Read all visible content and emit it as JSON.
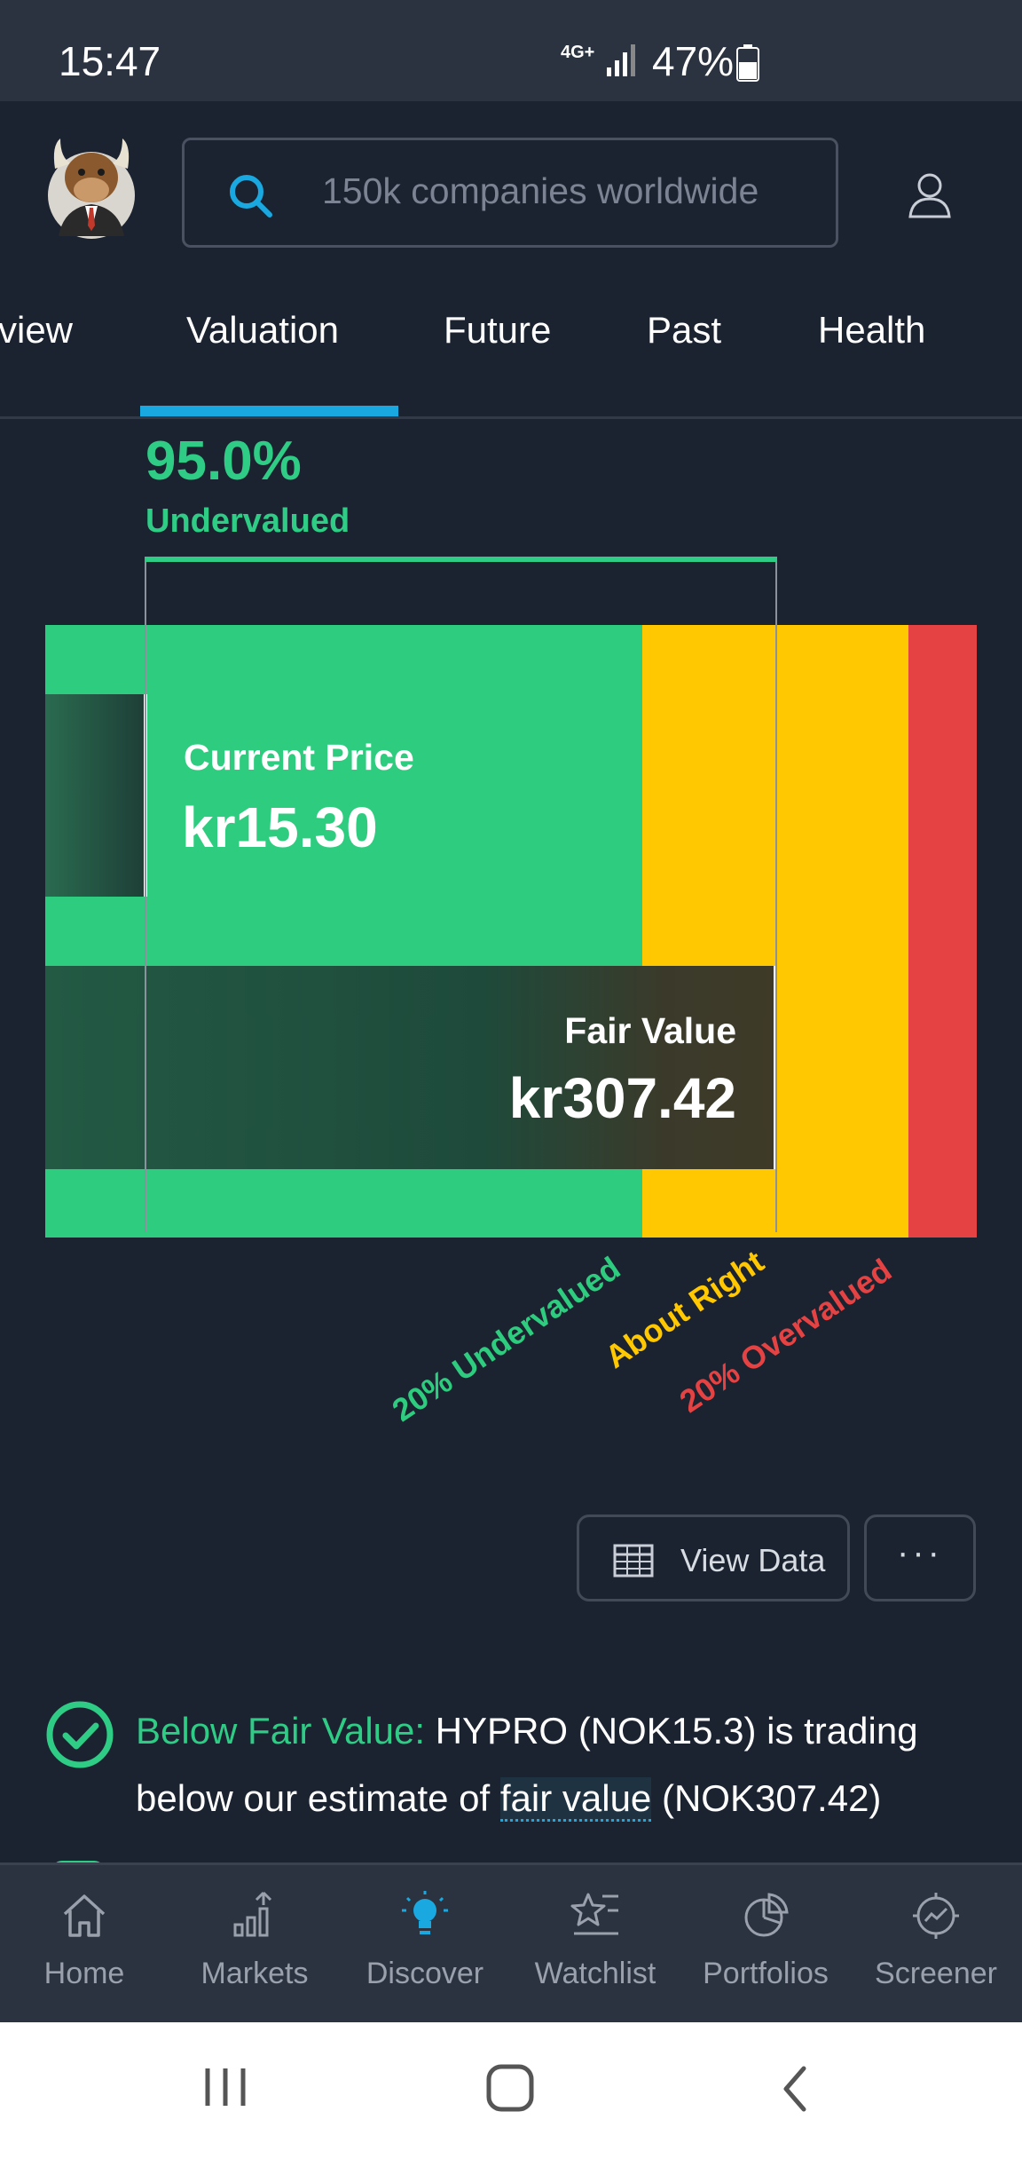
{
  "status": {
    "time": "15:47",
    "network": "4G+",
    "battery": "47%"
  },
  "search": {
    "placeholder": "150k companies worldwide"
  },
  "tabs": [
    "rview",
    "Valuation",
    "Future",
    "Past",
    "Health"
  ],
  "active_tab": "Valuation",
  "valuation": {
    "percent": "95.0%",
    "status": "Undervalued",
    "current_price_label": "Current Price",
    "current_price": "kr15.30",
    "fair_value_label": "Fair Value",
    "fair_value": "kr307.42",
    "zones": {
      "under": "20% Undervalued",
      "about": "About Right",
      "over": "20% Overvalued"
    },
    "colors": {
      "green": "#2ecc7f",
      "yellow": "#ffc800",
      "red": "#e54343",
      "accent": "#1aa8e0"
    }
  },
  "actions": {
    "view_data": "View Data",
    "more": "···"
  },
  "check": {
    "title": "Below Fair Value:",
    "text_a": " HYPRO (NOK15.3) is trading below our estimate of ",
    "link": "fair value",
    "text_b": " (NOK307.42)"
  },
  "nav": [
    {
      "label": "Home",
      "icon": "home-icon"
    },
    {
      "label": "Markets",
      "icon": "markets-icon"
    },
    {
      "label": "Discover",
      "icon": "lightbulb-icon"
    },
    {
      "label": "Watchlist",
      "icon": "watchlist-icon"
    },
    {
      "label": "Portfolios",
      "icon": "portfolio-icon"
    },
    {
      "label": "Screener",
      "icon": "screener-icon"
    }
  ]
}
